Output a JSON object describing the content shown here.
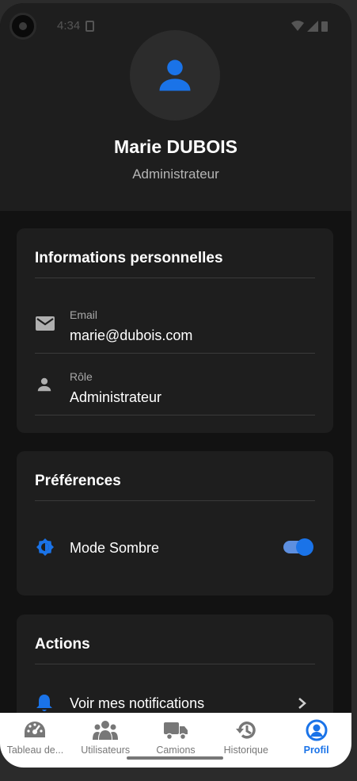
{
  "status_bar": {
    "time": "4:34"
  },
  "header": {
    "name": "Marie DUBOIS",
    "role": "Administrateur"
  },
  "personal_info": {
    "title": "Informations personnelles",
    "email_label": "Email",
    "email_value": "marie@dubois.com",
    "role_label": "Rôle",
    "role_value": "Administrateur"
  },
  "preferences": {
    "title": "Préférences",
    "dark_mode_label": "Mode Sombre",
    "dark_mode_enabled": true
  },
  "actions": {
    "title": "Actions",
    "notifications_label": "Voir mes notifications"
  },
  "bottom_nav": {
    "items": [
      {
        "label": "Tableau de...",
        "icon": "dashboard-icon",
        "active": false
      },
      {
        "label": "Utilisateurs",
        "icon": "users-icon",
        "active": false
      },
      {
        "label": "Camions",
        "icon": "truck-icon",
        "active": false
      },
      {
        "label": "Historique",
        "icon": "history-icon",
        "active": false
      },
      {
        "label": "Profil",
        "icon": "profile-icon",
        "active": true
      }
    ]
  },
  "colors": {
    "accent": "#1a73e8",
    "background": "#121212",
    "card": "#1e1e1e"
  }
}
